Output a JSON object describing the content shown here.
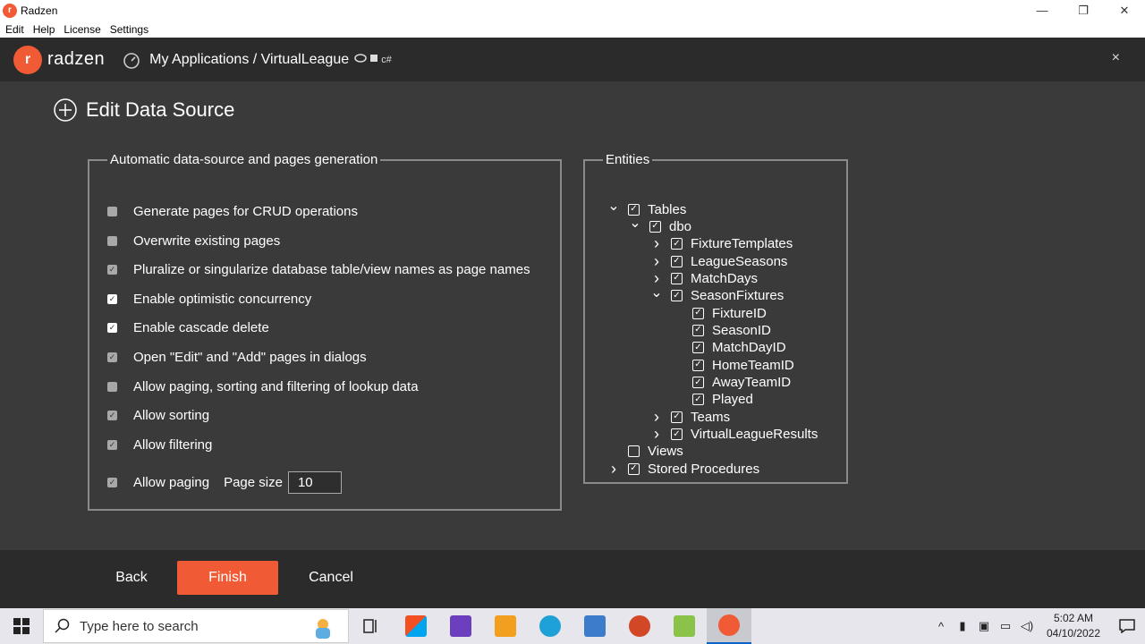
{
  "window": {
    "title": "Radzen",
    "controls": {
      "minimize": "—",
      "maximize": "❐",
      "close": "✕"
    }
  },
  "menu": [
    "Edit",
    "Help",
    "License",
    "Settings"
  ],
  "header": {
    "logo_text": "radzen",
    "breadcrumb": "My Applications / VirtualLeague",
    "tags": "c#",
    "close": "×"
  },
  "page": {
    "title": "Edit Data Source"
  },
  "options": {
    "legend": "Automatic data-source and pages generation",
    "items": [
      {
        "label": "Generate pages for CRUD operations",
        "checked": false
      },
      {
        "label": "Overwrite existing pages",
        "checked": false
      },
      {
        "label": "Pluralize or singularize database table/view names as page names",
        "checked": true
      },
      {
        "label": "Enable optimistic concurrency",
        "checked": true
      },
      {
        "label": "Enable cascade delete",
        "checked": true
      },
      {
        "label": "Open \"Edit\" and \"Add\" pages in dialogs",
        "checked": true
      },
      {
        "label": "Allow paging, sorting and filtering of lookup data",
        "checked": false
      },
      {
        "label": "Allow sorting",
        "checked": true
      },
      {
        "label": "Allow filtering",
        "checked": true
      },
      {
        "label": "Allow paging",
        "checked": true
      }
    ],
    "page_size_label": "Page size",
    "page_size_value": "10"
  },
  "entities": {
    "legend": "Entities",
    "tree": [
      {
        "label": "Tables",
        "level": 0,
        "chevron": "down",
        "checked": true
      },
      {
        "label": "dbo",
        "level": 1,
        "chevron": "down",
        "checked": true
      },
      {
        "label": "FixtureTemplates",
        "level": 2,
        "chevron": "right",
        "checked": true
      },
      {
        "label": "LeagueSeasons",
        "level": 2,
        "chevron": "right",
        "checked": true
      },
      {
        "label": "MatchDays",
        "level": 2,
        "chevron": "right",
        "checked": true
      },
      {
        "label": "SeasonFixtures",
        "level": 2,
        "chevron": "down",
        "checked": true
      },
      {
        "label": "FixtureID",
        "level": 3,
        "chevron": "none",
        "checked": true
      },
      {
        "label": "SeasonID",
        "level": 3,
        "chevron": "none",
        "checked": true
      },
      {
        "label": "MatchDayID",
        "level": 3,
        "chevron": "none",
        "checked": true
      },
      {
        "label": "HomeTeamID",
        "level": 3,
        "chevron": "none",
        "checked": true
      },
      {
        "label": "AwayTeamID",
        "level": 3,
        "chevron": "none",
        "checked": true
      },
      {
        "label": "Played",
        "level": 3,
        "chevron": "none",
        "checked": true
      },
      {
        "label": "Teams",
        "level": 2,
        "chevron": "right",
        "checked": true
      },
      {
        "label": "VirtualLeagueResults",
        "level": 2,
        "chevron": "right",
        "checked": true
      },
      {
        "label": "Views",
        "level": 0,
        "chevron": "none",
        "checked": false
      },
      {
        "label": "Stored Procedures",
        "level": 0,
        "chevron": "right",
        "checked": true
      }
    ]
  },
  "footer": {
    "back": "Back",
    "finish": "Finish",
    "cancel": "Cancel"
  },
  "taskbar": {
    "search_placeholder": "Type here to search",
    "time": "5:02 AM",
    "date": "04/10/2022"
  },
  "colors": {
    "accent": "#f05a35",
    "background": "#3a3a3a",
    "header": "#2b2b2b"
  }
}
